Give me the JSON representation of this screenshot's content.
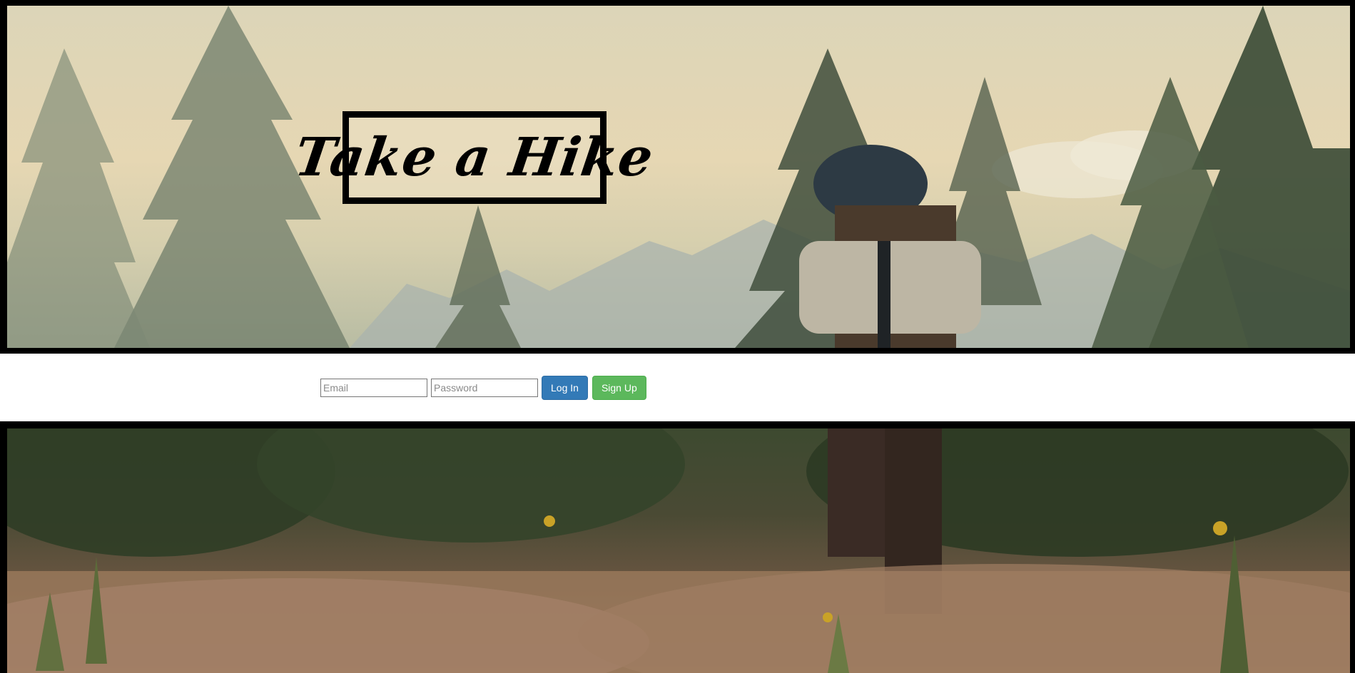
{
  "header": {
    "logo_text": "Take a Hike"
  },
  "login": {
    "email_placeholder": "Email",
    "password_placeholder": "Password",
    "login_label": "Log In",
    "signup_label": "Sign Up"
  },
  "colors": {
    "login_button": "#337ab7",
    "signup_button": "#5cb85c",
    "frame": "#000000"
  }
}
